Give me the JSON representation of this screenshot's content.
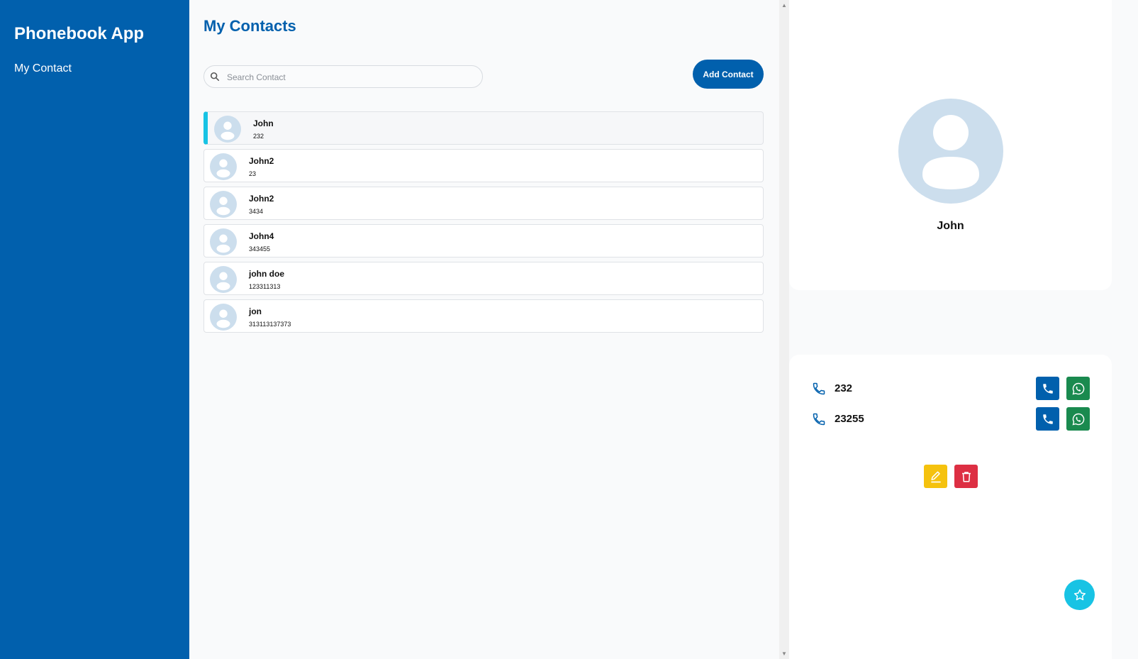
{
  "sidebar": {
    "app_title": "Phonebook App",
    "nav_item": "My Contact"
  },
  "main": {
    "title": "My Contacts",
    "search_placeholder": "Search Contact",
    "add_button": "Add Contact",
    "contacts": [
      {
        "name": "John",
        "number": "232"
      },
      {
        "name": "John2",
        "number": "23"
      },
      {
        "name": "John2",
        "number": "3434"
      },
      {
        "name": "John4",
        "number": "343455"
      },
      {
        "name": "john doe",
        "number": "123311313"
      },
      {
        "name": "jon",
        "number": "313113137373"
      }
    ]
  },
  "detail": {
    "name": "John",
    "phones": [
      "232",
      "23255"
    ]
  },
  "colors": {
    "primary": "#0160ad",
    "accent": "#18c3e4",
    "whatsapp": "#1a8a4f",
    "edit": "#f5c20e",
    "delete": "#dd2f43"
  }
}
